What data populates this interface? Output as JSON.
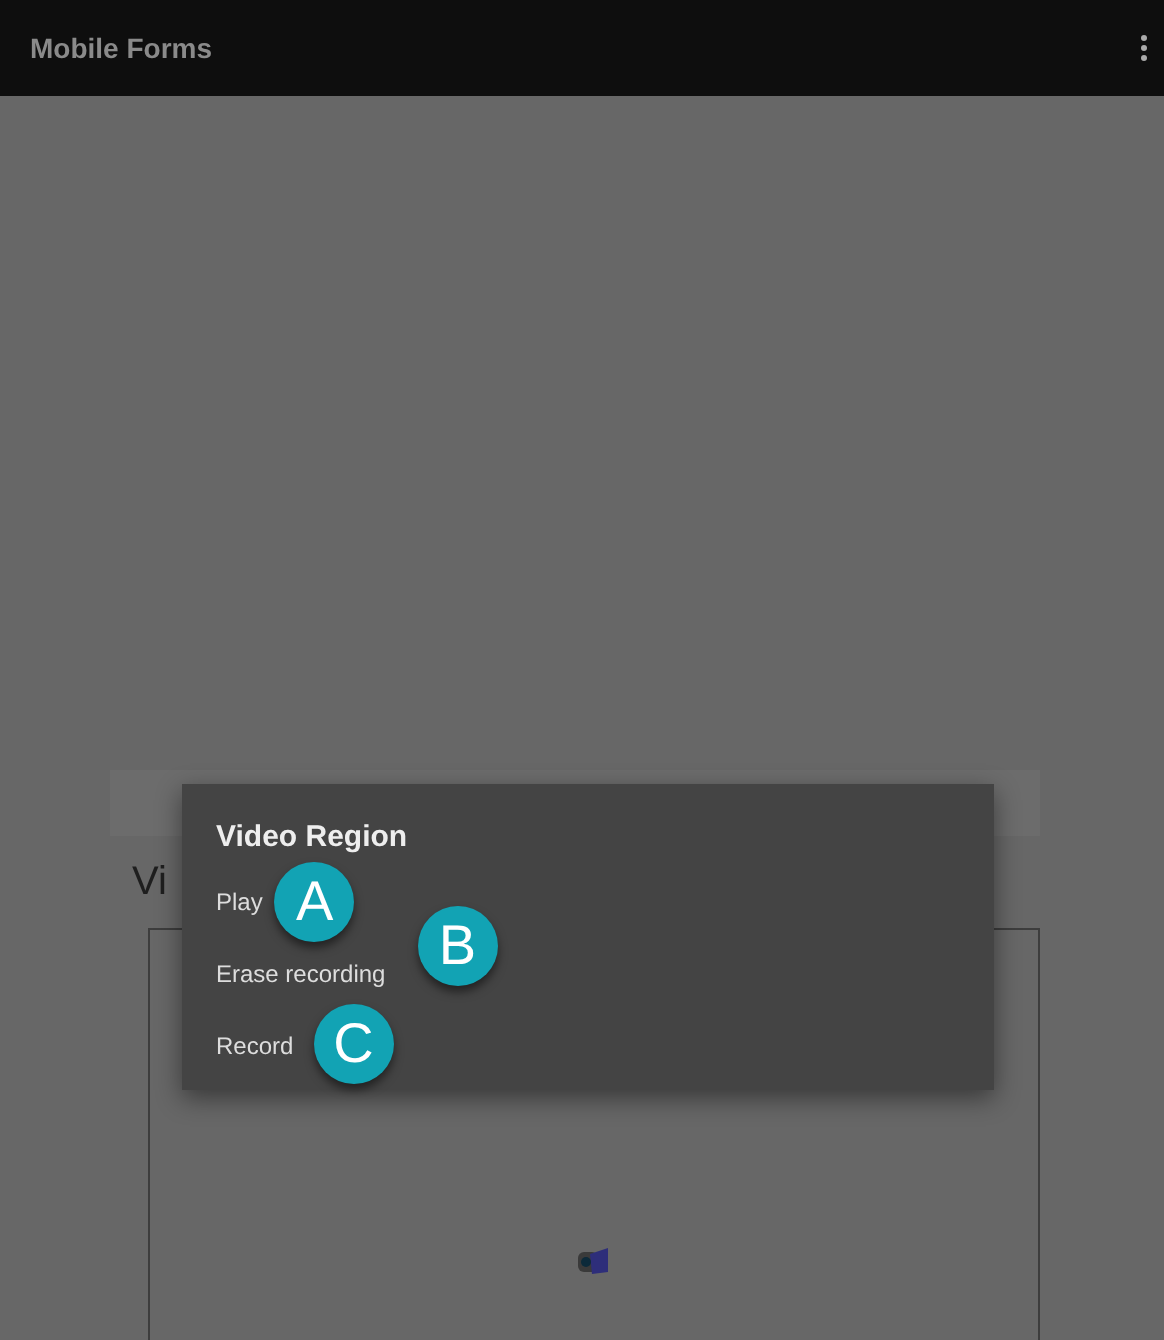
{
  "app_bar": {
    "title": "Mobile Forms"
  },
  "form": {
    "field_label": "Vi"
  },
  "menu": {
    "title": "Video Region",
    "items": [
      {
        "label": "Play",
        "callout": "A"
      },
      {
        "label": "Erase recording",
        "callout": "B"
      },
      {
        "label": "Record",
        "callout": "C"
      }
    ]
  }
}
